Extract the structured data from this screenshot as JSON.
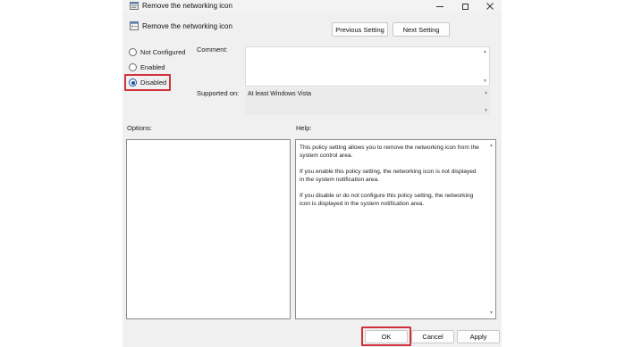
{
  "window": {
    "title": "Remove the networking icon",
    "minimize_icon": "minimize-icon",
    "maximize_icon": "maximize-icon",
    "close_icon": "close-icon"
  },
  "header": {
    "policy_name": "Remove the networking icon",
    "previous_label": "Previous Setting",
    "next_label": "Next Setting"
  },
  "state": {
    "options": [
      {
        "label": "Not Configured",
        "selected": false
      },
      {
        "label": "Enabled",
        "selected": false
      },
      {
        "label": "Disabled",
        "selected": true
      }
    ],
    "highlight_color": "#d0323c",
    "radio_color": "#1e4f9a"
  },
  "comment": {
    "label": "Comment:",
    "value": ""
  },
  "supported": {
    "label": "Supported on:",
    "value": "At least Windows Vista"
  },
  "options_panel": {
    "label": "Options:"
  },
  "help_panel": {
    "label": "Help:",
    "paragraphs": [
      "This policy setting allows you to remove the networking icon from the system control area.",
      "If you enable this policy setting, the networking icon is not displayed in the system notification area.",
      "If you disable or do not configure this policy setting, the networking icon is displayed in the system notification area."
    ]
  },
  "footer": {
    "ok_label": "OK",
    "cancel_label": "Cancel",
    "apply_label": "Apply"
  }
}
